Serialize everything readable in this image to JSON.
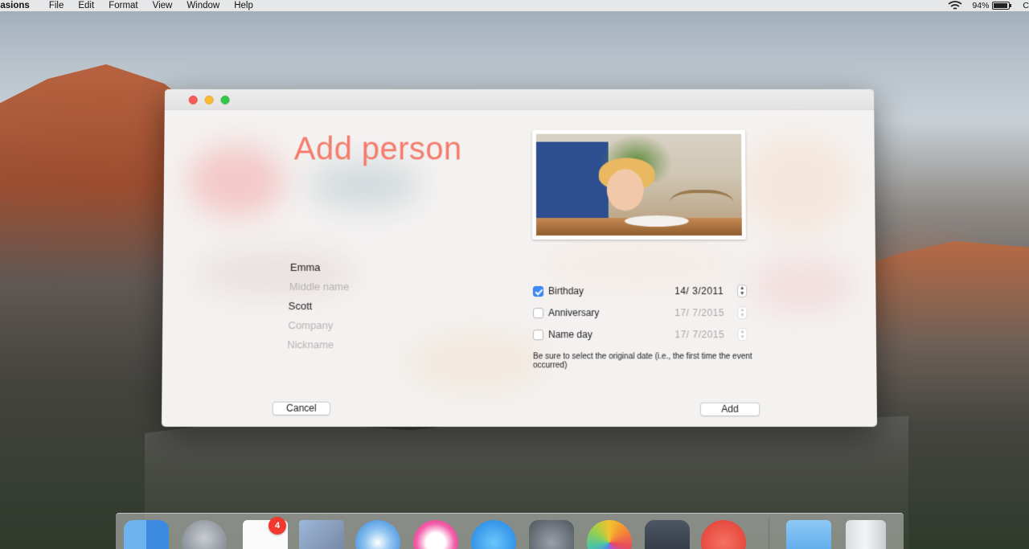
{
  "menubar": {
    "app_name": "casions",
    "items": [
      "File",
      "Edit",
      "Format",
      "View",
      "Window",
      "Help"
    ],
    "battery": "94%",
    "trailing": "C"
  },
  "window": {
    "title": "Add person",
    "photo_icon": "child-photo",
    "fields": {
      "first_name": "Emma",
      "middle_name_placeholder": "Middle name",
      "last_name": "Scott",
      "company_placeholder": "Company",
      "nickname_placeholder": "Nickname"
    },
    "events": [
      {
        "label": "Birthday",
        "checked": true,
        "date": "14/  3/2011"
      },
      {
        "label": "Anniversary",
        "checked": false,
        "date": "17/  7/2015"
      },
      {
        "label": "Name day",
        "checked": false,
        "date": "17/  7/2015"
      }
    ],
    "note": "Be sure to select the original date (i.e., the first time the event occurred)",
    "cancel_label": "Cancel",
    "add_label": "Add"
  },
  "dock": {
    "items": [
      "finder-icon",
      "launchpad-icon",
      "reminders-icon",
      "mail-stamp-icon",
      "safari-icon",
      "itunes-icon",
      "app-store-icon",
      "system-preferences-icon",
      "photos-icon",
      "mission-control-icon",
      "occasions-gift-icon",
      "downloads-folder-icon",
      "trash-icon"
    ],
    "reminders_badge": "4"
  },
  "colors": {
    "title": "#f47c6c",
    "accent": "#3d8af7"
  }
}
